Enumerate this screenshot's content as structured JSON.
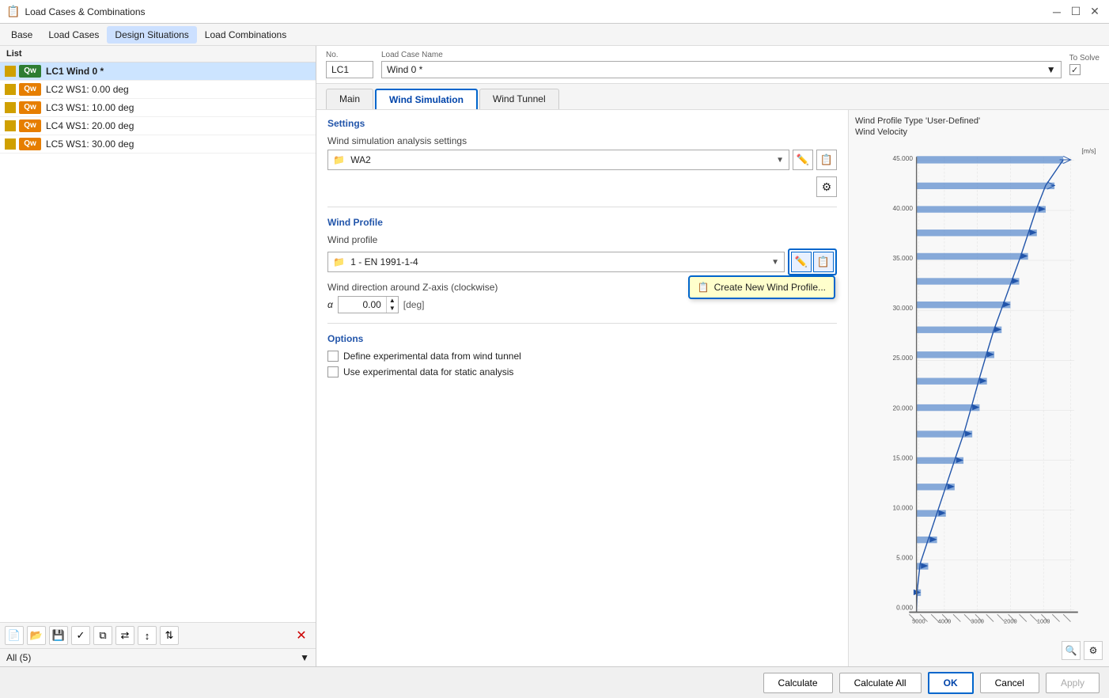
{
  "window": {
    "title": "Load Cases & Combinations",
    "icon": "📋"
  },
  "menu": {
    "items": [
      "Base",
      "Load Cases",
      "Design Situations",
      "Load Combinations"
    ],
    "active": "Base"
  },
  "list": {
    "header": "List",
    "items": [
      {
        "id": 1,
        "badge": "Qw",
        "badge_type": "green",
        "name": "LC1  Wind 0 *",
        "selected": true
      },
      {
        "id": 2,
        "badge": "Qw",
        "badge_type": "orange",
        "name": "LC2  WS1: 0.00 deg",
        "selected": false
      },
      {
        "id": 3,
        "badge": "Qw",
        "badge_type": "orange",
        "name": "LC3  WS1: 10.00 deg",
        "selected": false
      },
      {
        "id": 4,
        "badge": "Qw",
        "badge_type": "orange",
        "name": "LC4  WS1: 20.00 deg",
        "selected": false
      },
      {
        "id": 5,
        "badge": "Qw",
        "badge_type": "orange",
        "name": "LC5  WS1: 30.00 deg",
        "selected": false
      }
    ],
    "footer": "All (5)"
  },
  "case_info": {
    "no_label": "No.",
    "no_value": "LC1",
    "name_label": "Load Case Name",
    "name_value": "Wind 0 *",
    "to_solve_label": "To Solve",
    "to_solve_checked": true
  },
  "tabs": {
    "items": [
      "Main",
      "Wind Simulation",
      "Wind Tunnel"
    ],
    "active": "Wind Simulation"
  },
  "settings": {
    "header": "Settings",
    "analysis_label": "Wind simulation analysis settings",
    "analysis_value": "WA2"
  },
  "wind_profile": {
    "header": "Wind Profile",
    "profile_label": "Wind profile",
    "profile_value": "1 - EN 1991-1-4",
    "direction_label": "Wind direction around Z-axis (clockwise)",
    "alpha_label": "α",
    "alpha_value": "0.00",
    "alpha_unit": "[deg]",
    "popup_label": "Create New Wind Profile..."
  },
  "options": {
    "header": "Options",
    "items": [
      {
        "label": "Define experimental data from wind tunnel",
        "checked": false
      },
      {
        "label": "Use experimental data for static analysis",
        "checked": false
      }
    ]
  },
  "chart": {
    "title1": "Wind Profile Type 'User-Defined'",
    "title2": "Wind Velocity",
    "y_label": "[m/s]",
    "x_labels": [
      "5000",
      "4000",
      "3000",
      "2000",
      "1000"
    ],
    "y_values": [
      "45.000",
      "40.000",
      "35.000",
      "30.000",
      "25.000",
      "20.000",
      "15.000",
      "10.000",
      "5.000",
      "0.000"
    ]
  },
  "buttons": {
    "calculate": "Calculate",
    "calculate_all": "Calculate All",
    "ok": "OK",
    "cancel": "Cancel",
    "apply": "Apply"
  },
  "toolbar": {
    "new_icon": "📄",
    "open_icon": "📂",
    "save_icon": "💾",
    "check_icon": "✓",
    "duplicate_icon": "⧉",
    "renumber_icon": "🔢",
    "sort_icon": "↕",
    "delete_icon": "✕"
  }
}
